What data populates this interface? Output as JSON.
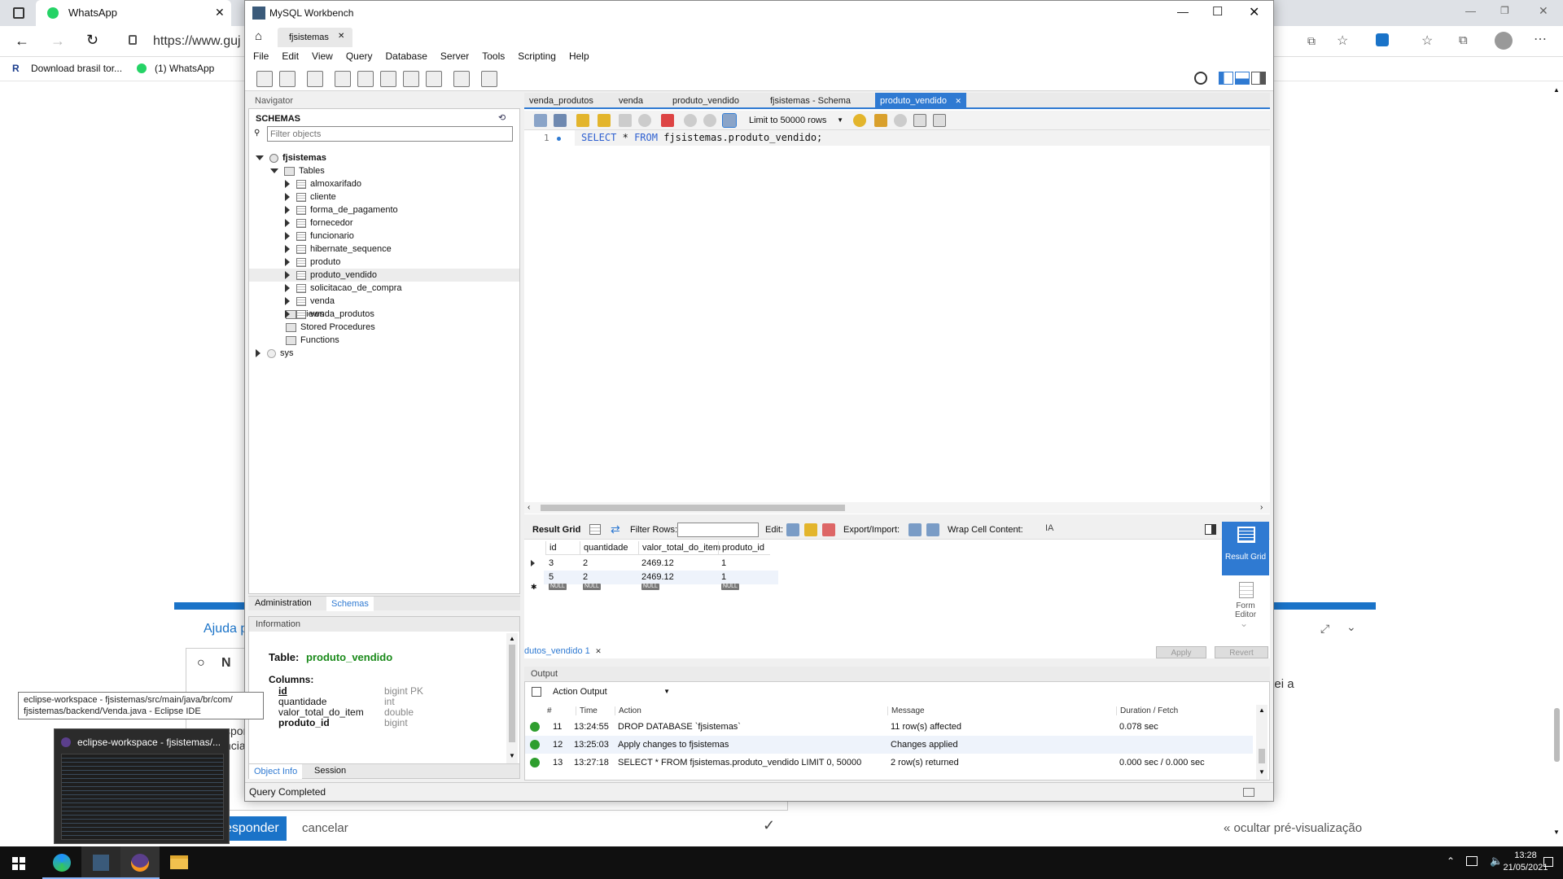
{
  "browser": {
    "tabs": [
      {
        "label": "WhatsApp"
      }
    ],
    "url": "https://www.guj",
    "bookmarks": [
      "Download brasil tor...",
      "(1) WhatsApp"
    ],
    "page": {
      "help_title": "Ajuda p",
      "editor_letter": "N",
      "fragment_right": "mentei a",
      "fragment_left_1": "spor",
      "fragment_left_2": "ncia",
      "respond_button": "esponder",
      "cancel_link": "cancelar",
      "hide_preview_link": "« ocultar pré-visualização"
    }
  },
  "workbench": {
    "window_title": "MySQL Workbench",
    "connection_tab": "fjsistemas",
    "menu": [
      "File",
      "Edit",
      "View",
      "Query",
      "Database",
      "Server",
      "Tools",
      "Scripting",
      "Help"
    ],
    "navigator": {
      "header": "Navigator",
      "schemas_label": "SCHEMAS",
      "filter_placeholder": "Filter objects",
      "schema_name": "fjsistemas",
      "tables_label": "Tables",
      "tables": [
        "almoxarifado",
        "cliente",
        "forma_de_pagamento",
        "fornecedor",
        "funcionario",
        "hibernate_sequence",
        "produto",
        "produto_vendido",
        "solicitacao_de_compra",
        "venda",
        "venda_produtos"
      ],
      "selected_table": "produto_vendido",
      "views_label": "Views",
      "stored_procedures_label": "Stored Procedures",
      "functions_label": "Functions",
      "other_schema": "sys",
      "bottom_tabs": [
        "Administration",
        "Schemas"
      ]
    },
    "information": {
      "header": "Information",
      "table_label": "Table:",
      "table_name": "produto_vendido",
      "columns_label": "Columns:",
      "columns": [
        {
          "name": "id",
          "type": "bigint PK"
        },
        {
          "name": "quantidade",
          "type": "int"
        },
        {
          "name": "valor_total_do_item",
          "type": "double"
        },
        {
          "name": "produto_id",
          "type": "bigint"
        }
      ],
      "bottom_tabs": [
        "Object Info",
        "Session"
      ]
    },
    "editor": {
      "tabs": [
        "venda_produtos",
        "venda",
        "produto_vendido",
        "fjsistemas - Schema",
        "produto_vendido"
      ],
      "active_tab_index": 4,
      "limit_label": "Limit to 50000 rows",
      "line_number": "1",
      "sql_keyword_1": "SELECT",
      "sql_star": "*",
      "sql_keyword_2": "FROM",
      "sql_rest": "fjsistemas.produto_vendido;"
    },
    "result_toolbar": {
      "result_grid": "Result Grid",
      "filter_rows": "Filter Rows:",
      "edit": "Edit:",
      "export_import": "Export/Import:",
      "wrap_cell": "Wrap Cell Content:"
    },
    "result_grid": {
      "columns": [
        "id",
        "quantidade",
        "valor_total_do_item",
        "produto_id"
      ],
      "rows": [
        [
          "3",
          "2",
          "2469.12",
          "1"
        ],
        [
          "5",
          "2",
          "2469.12",
          "1"
        ]
      ],
      "null_label": "NULL"
    },
    "result_side": {
      "result_grid": "Result Grid",
      "form_editor": "Form Editor"
    },
    "result_tab": "dutos_vendido 1",
    "apply_button": "Apply",
    "revert_button": "Revert",
    "output": {
      "header": "Output",
      "selector": "Action Output",
      "columns": [
        "#",
        "Time",
        "Action",
        "Message",
        "Duration / Fetch"
      ],
      "rows": [
        {
          "num": "11",
          "time": "13:24:55",
          "action": "DROP DATABASE `fjsistemas`",
          "message": "11 row(s) affected",
          "duration": "0.078 sec"
        },
        {
          "num": "12",
          "time": "13:25:03",
          "action": "Apply changes to fjsistemas",
          "message": "Changes applied",
          "duration": ""
        },
        {
          "num": "13",
          "time": "13:27:18",
          "action": "SELECT * FROM fjsistemas.produto_vendido LIMIT 0, 50000",
          "message": "2 row(s) returned",
          "duration": "0.000 sec / 0.000 sec"
        }
      ]
    },
    "status": "Query Completed"
  },
  "eclipse": {
    "tooltip_line1": "eclipse-workspace - fjsistemas/src/main/java/br/com/",
    "tooltip_line2": "fjsistemas/backend/Venda.java - Eclipse IDE",
    "preview_title": "eclipse-workspace - fjsistemas/..."
  },
  "taskbar": {
    "time": "13:28",
    "date": "21/05/2021"
  },
  "colors": {
    "accent": "#2f7ad2",
    "schema_green": "#1a8a1a",
    "sql_keyword": "#2d5fd0",
    "ok": "#2e9e2e"
  }
}
